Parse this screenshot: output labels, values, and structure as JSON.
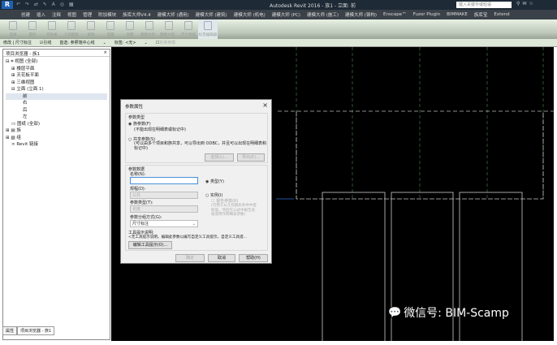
{
  "app": {
    "logo": "R",
    "title": "Autodesk Revit 2016 -   族1 - 立面: 前",
    "search_placeholder": "键入关键字或短语",
    "qat": "↶ ↷ ⇄ ✎ A ◎ ▦"
  },
  "tabs": [
    "创建",
    "插入",
    "注释",
    "视图",
    "管理",
    "附加模块",
    "族库大师V4.4",
    "建模大师 (通用)",
    "建模大师 (建筑)",
    "建模大师 (机电)",
    "建模大师 (PC)",
    "建模大师 (施工)",
    "建模大师 (钢构)",
    "Enscape™",
    "Fuzor Plugin",
    "BIMMAKE",
    "族库宝",
    "Extend"
  ],
  "ribbon": [
    "选择",
    "属性",
    "剪贴板",
    "几何图形",
    "修改",
    "测量",
    "创建",
    "建模大师...",
    "建模大师...",
    "尺寸界线",
    "标签编辑器"
  ],
  "options": {
    "context": "修改 | 尺寸标注",
    "leader": "引线",
    "prefer_label": "首选: 参照墙中心线",
    "label_label": "标签: <无>",
    "instance_param": "实例参数"
  },
  "browser": {
    "title": "项目浏览器 - 族1",
    "close": "×",
    "items": [
      "视图 (全部)",
      "楼层平面",
      "天花板平面",
      "三维视图",
      "立面 (立面 1)",
      "前",
      "右",
      "后",
      "左",
      "图纸 (全部)",
      "族",
      "组",
      "Revit 链接"
    ],
    "tabs": [
      "属性",
      "项目浏览器 - 族1"
    ]
  },
  "dialog": {
    "title": "参数属性",
    "close": "×",
    "param_type_group": "参数类型",
    "family_param": "族参数(F)",
    "family_note": "(不能出现在明细表或标记中)",
    "shared_param": "共享参数(S)",
    "shared_note": "(可以由多个项目和族共享，可以导出到 ODBC，并且可以出现在明细表和\n标记中)",
    "select_btn": "选择(L)...",
    "export_btn": "导出(E)...",
    "data_group": "参数数据",
    "name_label": "名称(N):",
    "name_value": "",
    "type_radio": "类型(Y)",
    "discipline_label": "规程(D):",
    "discipline_value": "公共",
    "instance_radio": "实例(I)",
    "report_param": "报告参数(R)",
    "report_note": "(可用于从几何图形条件中提\n取值，然后在公式中报告此\n值或用作明细表参数)",
    "param_type_label": "参数类型(T):",
    "param_type_value": "长度",
    "group_label": "参数分组方式(G):",
    "group_value": "尺寸标注",
    "tooltip_label": "工具提示说明:",
    "tooltip_value": "<无工具提示说明。编辑此参数以编写自定义工具提示。自定义工具提...",
    "edit_tooltip_btn": "编辑工具提示(O)...",
    "ok": "确定",
    "cancel": "取消",
    "help": "帮助(H)"
  },
  "watermark": "微信号: BIM-Scamp"
}
